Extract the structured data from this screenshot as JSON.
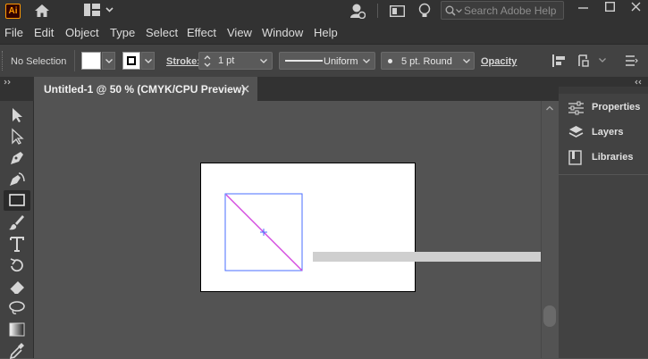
{
  "app": {
    "logo": "Ai",
    "search_placeholder": "Search Adobe Help"
  },
  "menu": [
    "File",
    "Edit",
    "Object",
    "Type",
    "Select",
    "Effect",
    "View",
    "Window",
    "Help"
  ],
  "control": {
    "selection": "No Selection",
    "stroke_label": "Stroke:",
    "stroke_weight": "1 pt",
    "profile": "Uniform",
    "brush": "5 pt. Round",
    "opacity": "Opacity"
  },
  "document": {
    "tab_title": "Untitled-1 @ 50 % (CMYK/CPU Preview)"
  },
  "panels": [
    "Properties",
    "Layers",
    "Libraries"
  ],
  "tools": [
    "selection-tool",
    "direct-selection-tool",
    "pen-tool",
    "curvature-tool",
    "rectangle-tool",
    "paintbrush-tool",
    "type-tool",
    "rotate-tool",
    "eraser-tool",
    "lasso-tool",
    "gradient-tool",
    "eyedropper-tool"
  ],
  "colors": {
    "accent": "#ff9a00",
    "selection": "#4a6cff",
    "path": "#d44be0"
  }
}
